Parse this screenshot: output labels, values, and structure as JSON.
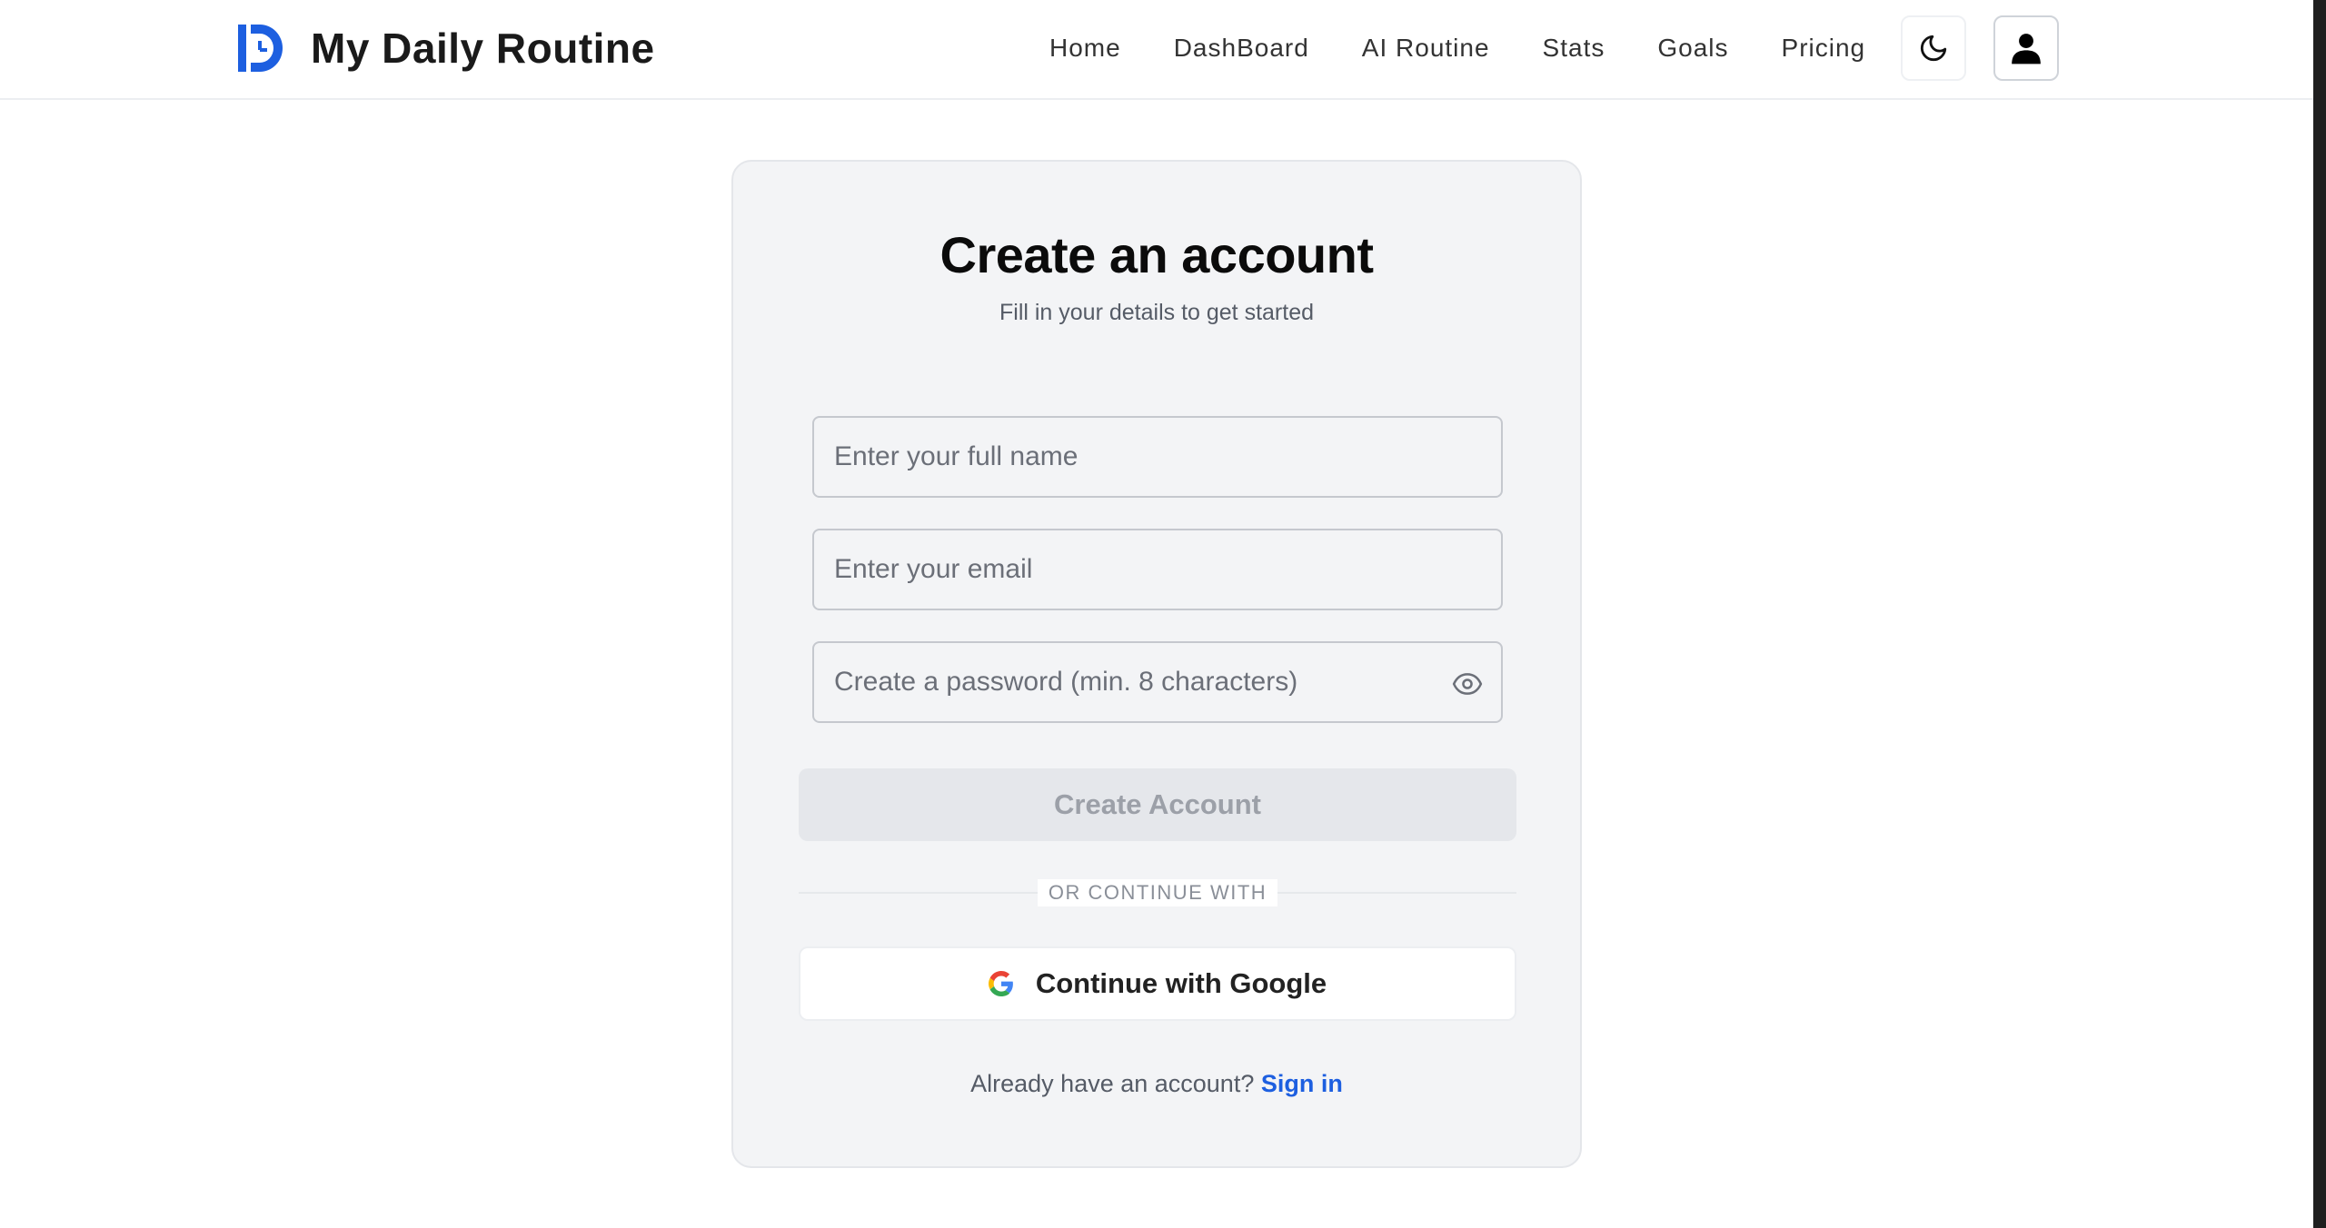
{
  "header": {
    "brand_title": "My Daily Routine",
    "nav": [
      "Home",
      "DashBoard",
      "AI Routine",
      "Stats",
      "Goals",
      "Pricing"
    ]
  },
  "icons": {
    "logo": "logo-icon",
    "theme": "moon-icon",
    "user": "user-icon",
    "password_toggle": "eye-icon",
    "google": "google-icon"
  },
  "form": {
    "title": "Create an account",
    "subtitle": "Fill in your details to get started",
    "name_placeholder": "Enter your full name",
    "email_placeholder": "Enter your email",
    "password_placeholder": "Create a password (min. 8 characters)",
    "submit_label": "Create Account",
    "divider_text": "OR CONTINUE WITH",
    "google_label": "Continue with Google",
    "signin_prompt": "Already have an account?",
    "signin_link": "Sign in"
  },
  "colors": {
    "brand_blue": "#1d5fe0",
    "card_bg": "#f3f4f6",
    "button_disabled": "#e5e7eb"
  }
}
